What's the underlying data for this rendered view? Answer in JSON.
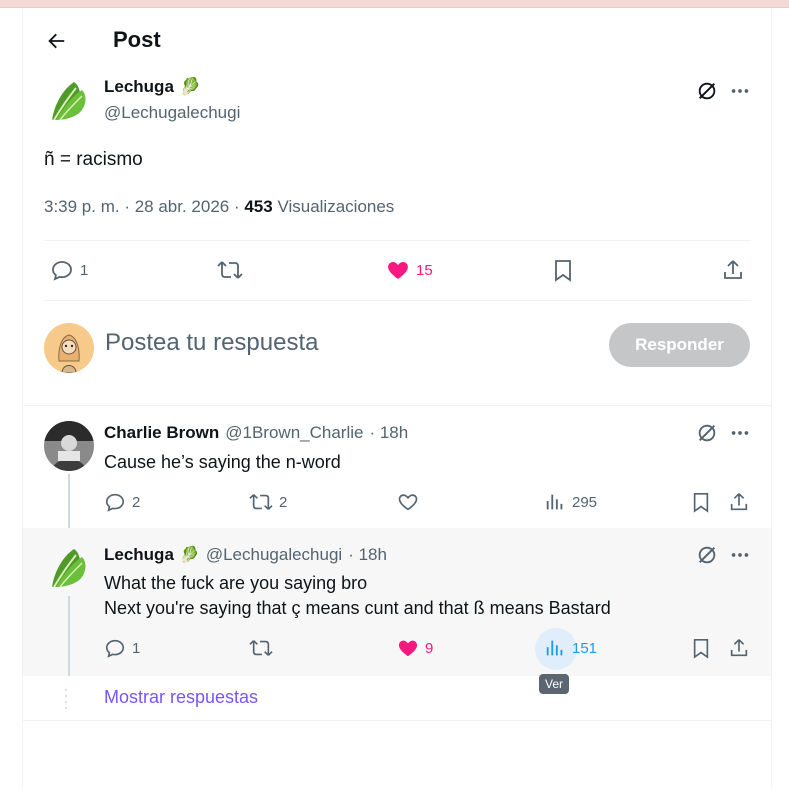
{
  "header": {
    "title": "Post"
  },
  "main_post": {
    "display_name": "Lechuga",
    "emoji": "🥬",
    "handle": "@Lechugalechugi",
    "text": "ñ = racismo",
    "timestamp": "3:39 p. m. · 28 abr. 2026 · ",
    "views_count": "453",
    "views_label": " Visualizaciones",
    "replies": "1",
    "likes": "15"
  },
  "composer": {
    "placeholder": "Postea tu respuesta",
    "button": "Responder"
  },
  "replies": [
    {
      "display_name": "Charlie Brown",
      "handle": "@1Brown_Charlie",
      "time": "· 18h",
      "text": "Cause he’s saying the n-word",
      "replies": "2",
      "reposts": "2",
      "views": "295"
    },
    {
      "display_name": "Lechuga",
      "emoji": "🥬",
      "handle": "@Lechugalechugi",
      "time": "· 18h",
      "text_line1": "What the fuck are you saying bro",
      "text_line2": "Next you're saying that ç means cunt and that ß means Bastard",
      "replies": "1",
      "likes": "9",
      "views": "151"
    }
  ],
  "tooltip": "Ver",
  "show_replies": "Mostrar respuestas",
  "colors": {
    "like": "#f91880",
    "views_hover": "#1d9bf0",
    "button_disabled": "#c4c6c8",
    "link": "#7856ff"
  }
}
